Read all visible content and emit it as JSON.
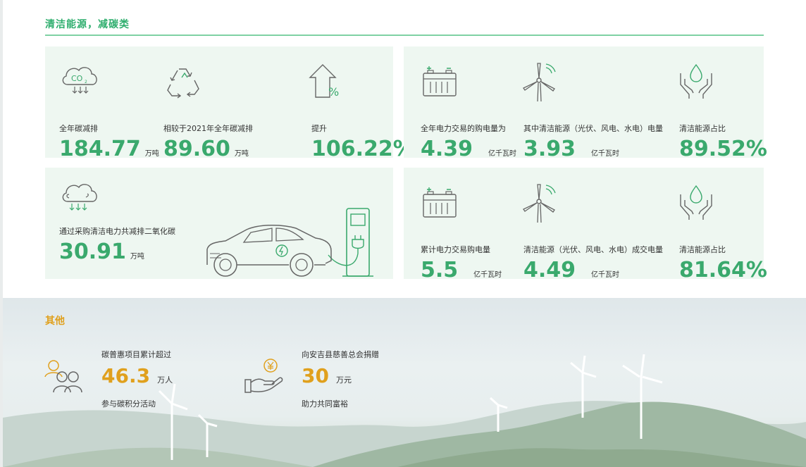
{
  "section1": {
    "title": "清洁能源，减碳类"
  },
  "card1": {
    "m1": {
      "label": "全年碳减排",
      "value": "184.77",
      "unit": "万吨",
      "icon": "co2-cloud-icon"
    },
    "m2": {
      "label": "相较于2021年全年碳减排",
      "value": "89.60",
      "unit": "万吨",
      "icon": "recycle-icon"
    },
    "m3": {
      "label": "提升",
      "value": "106.22%",
      "unit": "",
      "icon": "percent-up-arrow-icon"
    }
  },
  "card2": {
    "m1": {
      "label": "全年电力交易的购电量为",
      "value": "4.39",
      "unit": "亿千瓦时",
      "icon": "battery-icon"
    },
    "m2": {
      "label": "其中清洁能源（光伏、风电、水电）电量",
      "value": "3.93",
      "unit": "亿千瓦时",
      "icon": "wind-turbine-icon"
    },
    "m3": {
      "label": "清洁能源占比",
      "value": "89.52%",
      "unit": "",
      "icon": "hands-water-drop-icon"
    }
  },
  "card3": {
    "m1": {
      "label": "通过采购清洁电力共减排二氧化碳",
      "value": "30.91",
      "unit": "万吨",
      "icon": "cloud-rain-icon"
    }
  },
  "card4": {
    "m1": {
      "label": "累计电力交易购电量",
      "value": "5.5",
      "unit": "亿千瓦时",
      "icon": "battery-icon"
    },
    "m2": {
      "label": "清洁能源（光伏、风电、水电）成交电量",
      "value": "4.49",
      "unit": "亿千瓦时",
      "icon": "wind-turbine-icon"
    },
    "m3": {
      "label": "清洁能源占比",
      "value": "81.64%",
      "unit": "",
      "icon": "hands-water-drop-icon"
    }
  },
  "section2": {
    "title": "其他",
    "s1": {
      "label": "碳普惠项目累计超过",
      "value": "46.3",
      "unit": "万人",
      "sub": "参与碳积分活动",
      "icon": "people-icon"
    },
    "s2": {
      "label": "向安吉县慈善总会捐赠",
      "value": "30",
      "unit": "万元",
      "sub": "助力共同富裕",
      "icon": "hand-yuan-coin-icon"
    }
  },
  "colors": {
    "green": "#3aa96d",
    "card_bg": "#eef7f1",
    "gold": "#e0a01d"
  }
}
